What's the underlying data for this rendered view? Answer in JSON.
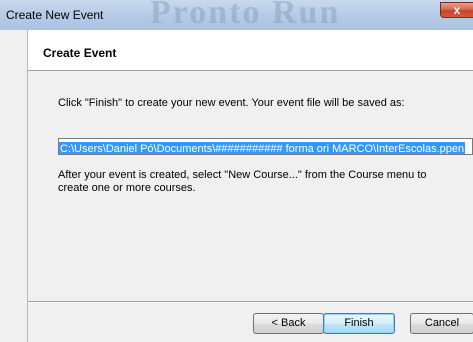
{
  "window": {
    "title": "Create New Event",
    "background_title": "Pronto Run",
    "close_glyph": "x"
  },
  "header": {
    "title": "Create Event"
  },
  "body": {
    "instruction": "Click \"Finish\" to create your new event. Your event file will be saved as:",
    "file_path": "C:\\Users\\Daniel Pó\\Documents\\########### forma ori MARCO\\InterEscolas.ppen",
    "after_text": "After your event is created, select \"New Course...\" from the Course menu to create one or more courses."
  },
  "buttons": {
    "back": "< Back",
    "finish": "Finish",
    "cancel": "Cancel"
  },
  "colors": {
    "selection": "#3399ff",
    "close_button": "#c7432a",
    "titlebar": "#b7cbe6"
  }
}
